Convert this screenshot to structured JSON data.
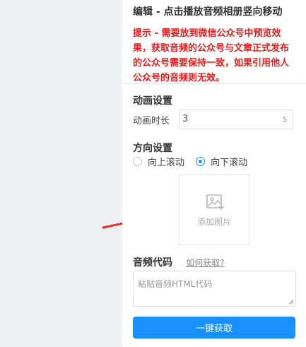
{
  "panel": {
    "title": "编辑 - 点击播放音频相册竖向移动",
    "warning": "提示 - 需要放到微信公众号中预览效果，获取音频的公众号与文章正式发布的公众号需要保持一致，如果引用他人公众号的音频则无效。"
  },
  "animation": {
    "section_title": "动画设置",
    "duration_label": "动画时长",
    "duration_value": "3",
    "duration_unit": "s"
  },
  "direction": {
    "section_title": "方向设置",
    "options": [
      {
        "label": "向上滚动",
        "checked": false
      },
      {
        "label": "向下滚动",
        "checked": true
      }
    ]
  },
  "upload": {
    "label": "添加图片",
    "icon": "image-add-icon"
  },
  "audio": {
    "section_title": "音频代码",
    "help_link": "如何获取?",
    "placeholder": "粘贴音频HTML代码"
  },
  "action": {
    "button_label": "一键获取"
  },
  "colors": {
    "accent": "#1890ff",
    "warning": "#e02020",
    "arrow": "#e8312f",
    "left_background": "#eef0f3"
  }
}
